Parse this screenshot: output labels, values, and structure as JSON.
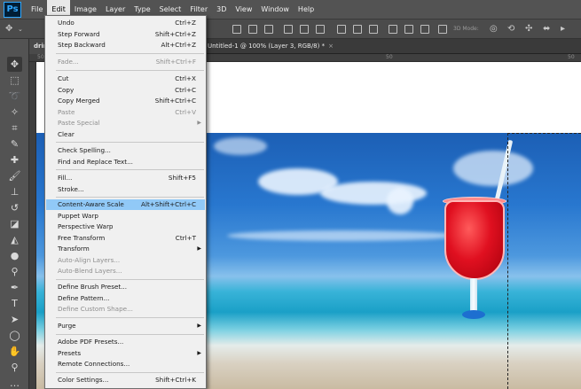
{
  "menubar": {
    "logo": "Ps",
    "items": [
      "File",
      "Edit",
      "Image",
      "Layer",
      "Type",
      "Select",
      "Filter",
      "3D",
      "View",
      "Window",
      "Help"
    ],
    "active": "Edit"
  },
  "options_bar": {
    "mode_3d_label": "3D Mode:"
  },
  "tabs": {
    "doc1": "drink",
    "doc2": "Untitled-1 @ 100% (Layer 3, RGB/8) *",
    "close": "×"
  },
  "ruler": {
    "top": [
      "50"
    ],
    "top2": "50",
    "top3": "50"
  },
  "edit_menu": {
    "undo": {
      "label": "Undo",
      "shortcut": "Ctrl+Z"
    },
    "step_forward": {
      "label": "Step Forward",
      "shortcut": "Shift+Ctrl+Z"
    },
    "step_backward": {
      "label": "Step Backward",
      "shortcut": "Alt+Ctrl+Z"
    },
    "fade": {
      "label": "Fade...",
      "shortcut": "Shift+Ctrl+F"
    },
    "cut": {
      "label": "Cut",
      "shortcut": "Ctrl+X"
    },
    "copy": {
      "label": "Copy",
      "shortcut": "Ctrl+C"
    },
    "copy_merged": {
      "label": "Copy Merged",
      "shortcut": "Shift+Ctrl+C"
    },
    "paste": {
      "label": "Paste",
      "shortcut": "Ctrl+V"
    },
    "paste_special": {
      "label": "Paste Special"
    },
    "clear": {
      "label": "Clear"
    },
    "check_spelling": {
      "label": "Check Spelling..."
    },
    "find_replace": {
      "label": "Find and Replace Text..."
    },
    "fill": {
      "label": "Fill...",
      "shortcut": "Shift+F5"
    },
    "stroke": {
      "label": "Stroke..."
    },
    "content_aware_scale": {
      "label": "Content-Aware Scale",
      "shortcut": "Alt+Shift+Ctrl+C"
    },
    "puppet_warp": {
      "label": "Puppet Warp"
    },
    "perspective_warp": {
      "label": "Perspective Warp"
    },
    "free_transform": {
      "label": "Free Transform",
      "shortcut": "Ctrl+T"
    },
    "transform": {
      "label": "Transform"
    },
    "auto_align": {
      "label": "Auto-Align Layers..."
    },
    "auto_blend": {
      "label": "Auto-Blend Layers..."
    },
    "define_brush": {
      "label": "Define Brush Preset..."
    },
    "define_pattern": {
      "label": "Define Pattern..."
    },
    "define_shape": {
      "label": "Define Custom Shape..."
    },
    "purge": {
      "label": "Purge"
    },
    "pdf_presets": {
      "label": "Adobe PDF Presets..."
    },
    "presets": {
      "label": "Presets"
    },
    "remote_connections": {
      "label": "Remote Connections..."
    },
    "color_settings": {
      "label": "Color Settings...",
      "shortcut": "Shift+Ctrl+K"
    }
  },
  "icons": {
    "submenu_arrow": "▶"
  }
}
